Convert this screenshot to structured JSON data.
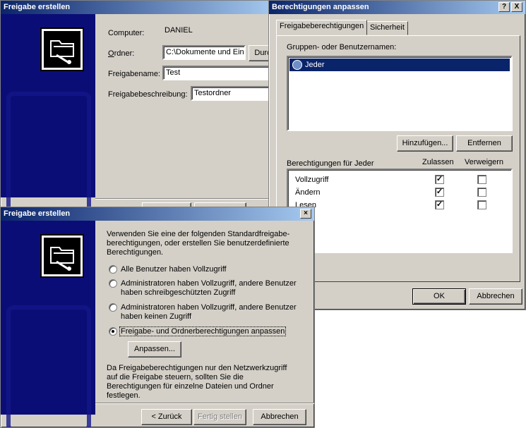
{
  "window1": {
    "title": "Freigabe erstellen",
    "computer_label": "Computer:",
    "computer_value": "DANIEL",
    "ordner_label": "Ordner:",
    "ordner_value": "C:\\Dokumente und Ein",
    "browse_label": "Durc",
    "freigabename_label": "Freigabename:",
    "freigabename_value": "Test",
    "beschreibung_label": "Freigabebeschreibung:",
    "beschreibung_value": "Testordner"
  },
  "window2": {
    "title": "Berechtigungen anpassen",
    "help_btn": "?",
    "close_btn": "X",
    "tabs": [
      "Freigabeberechtigungen",
      "Sicherheit"
    ],
    "groups_label": "Gruppen- oder Benutzernamen:",
    "groups": [
      "Jeder"
    ],
    "add_button": "Hinzufügen...",
    "remove_button": "Entfernen",
    "perm_header": "Berechtigungen für Jeder",
    "allow_header": "Zulassen",
    "deny_header": "Verweigern",
    "permissions": [
      {
        "name": "Vollzugriff",
        "allow": true,
        "deny": false
      },
      {
        "name": "Ändern",
        "allow": true,
        "deny": false
      },
      {
        "name": "Lesen",
        "allow": true,
        "deny": false
      }
    ],
    "ok_button": "OK",
    "cancel_button": "Abbrechen"
  },
  "window3": {
    "title": "Freigabe erstellen",
    "close_btn": "×",
    "intro": "Verwenden Sie eine der folgenden Standardfreigabe-berechtigungen, oder erstellen Sie benutzerdefinierte Berechtigungen.",
    "options": [
      {
        "label": "Alle Benutzer haben Vollzugriff",
        "checked": false
      },
      {
        "label": "Administratoren haben Vollzugriff, andere Benutzer haben schreibgeschützten Zugriff",
        "checked": false
      },
      {
        "label": "Administratoren haben Vollzugriff, andere Benutzer haben keinen Zugriff",
        "checked": false
      },
      {
        "label": "Freigabe- und Ordnerberechtigungen anpassen",
        "checked": true
      }
    ],
    "customize_button": "Anpassen...",
    "note": "Da Freigabeberechtigungen nur den Netzwerkzugriff auf die Freigabe steuern, sollten Sie die Berechtigungen für einzelne Dateien und Ordner festlegen.",
    "back_button": "< Zurück",
    "finish_button": "Fertig stellen",
    "cancel_button": "Abbrechen"
  },
  "colors": {
    "titlebar": "#0a246a",
    "face": "#d4d0c8",
    "sidebar": "#0b0d76"
  }
}
